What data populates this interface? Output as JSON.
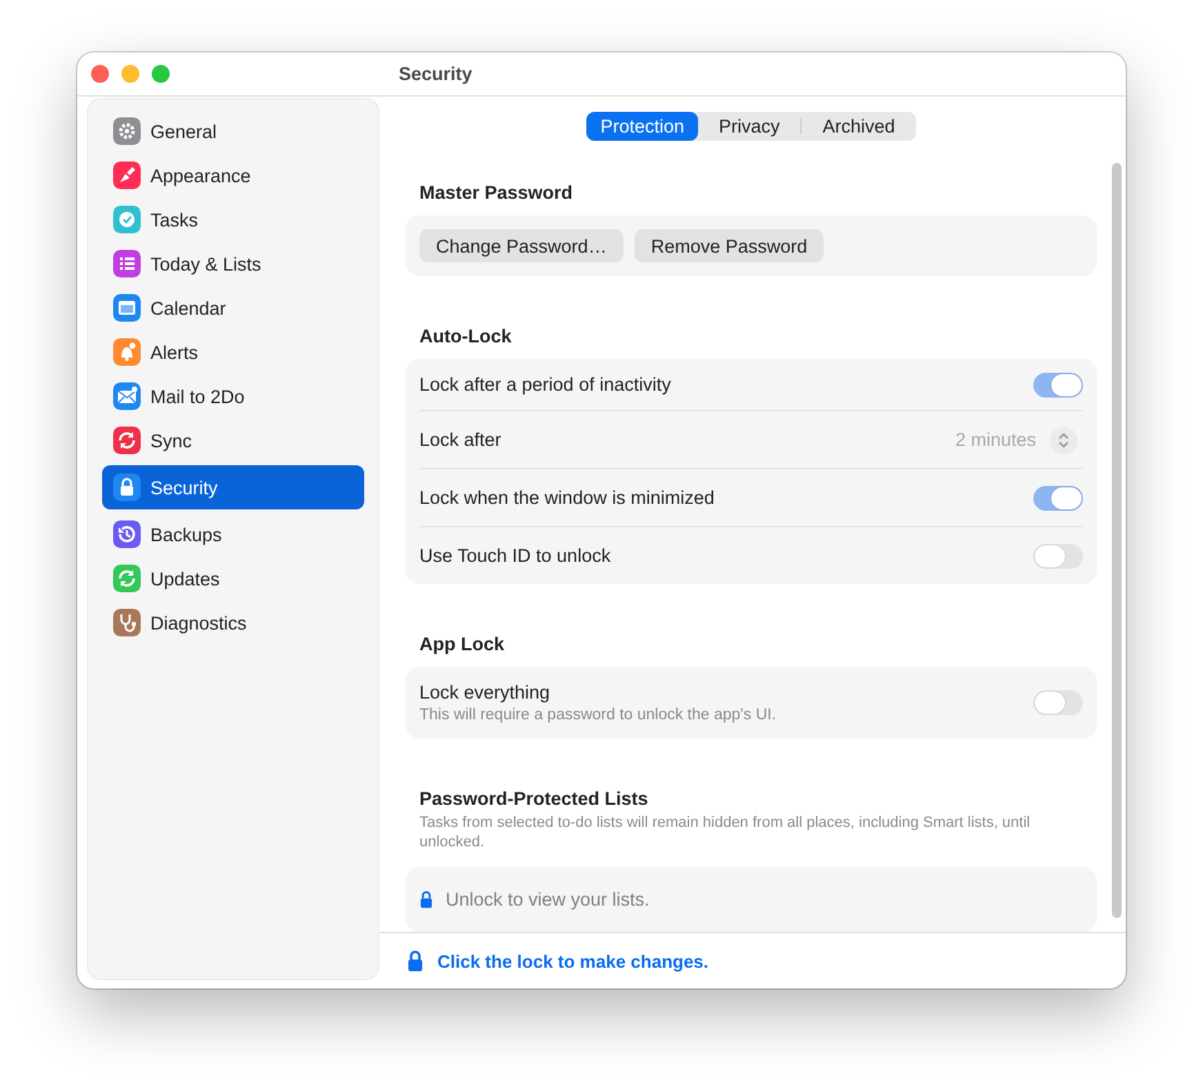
{
  "window": {
    "title": "Security"
  },
  "sidebar": {
    "items": [
      {
        "label": "General",
        "color": "#8e8e93",
        "selected": false
      },
      {
        "label": "Appearance",
        "color": "#ff2d55",
        "selected": false
      },
      {
        "label": "Tasks",
        "color": "#30c0d0",
        "selected": false
      },
      {
        "label": "Today & Lists",
        "color": "#bf3fe0",
        "selected": false
      },
      {
        "label": "Calendar",
        "color": "#1e88f0",
        "selected": false
      },
      {
        "label": "Alerts",
        "color": "#ff8a30",
        "selected": false
      },
      {
        "label": "Mail to 2Do",
        "color": "#1e88f0",
        "selected": false
      },
      {
        "label": "Sync",
        "color": "#f0304a",
        "selected": false
      },
      {
        "label": "Security",
        "color": "#1e88f0",
        "selected": true
      },
      {
        "label": "Backups",
        "color": "#6a5cf0",
        "selected": false
      },
      {
        "label": "Updates",
        "color": "#34c759",
        "selected": false
      },
      {
        "label": "Diagnostics",
        "color": "#a8785a",
        "selected": false
      }
    ]
  },
  "tabs": [
    {
      "label": "Protection",
      "selected": true
    },
    {
      "label": "Privacy",
      "selected": false
    },
    {
      "label": "Archived",
      "selected": false
    }
  ],
  "sections": [
    {
      "title": "Master Password",
      "kind": "buttons",
      "buttons": [
        "Change Password…",
        "Remove Password"
      ]
    },
    {
      "title": "Auto-Lock",
      "kind": "rows",
      "rows": [
        {
          "kind": "toggle",
          "label": "Lock after a period of inactivity",
          "on": true
        },
        {
          "kind": "stepper",
          "label": "Lock after",
          "value": "2 minutes"
        },
        {
          "kind": "toggle",
          "label": "Lock when the window is minimized",
          "on": true
        },
        {
          "kind": "toggle",
          "label": "Use Touch ID to unlock",
          "on": false
        }
      ]
    },
    {
      "title": "App Lock",
      "kind": "rows",
      "rows": [
        {
          "kind": "toggle",
          "label": "Lock everything",
          "note": "This will require a password to unlock the app's UI.",
          "on": false
        }
      ]
    },
    {
      "title": "Password-Protected Lists",
      "kind": "locked",
      "description": "Tasks from selected to-do lists will remain hidden from all places, including Smart lists, until unlocked.",
      "message": "Unlock to view your lists."
    }
  ],
  "footer": {
    "link": "Click the lock to make changes."
  }
}
